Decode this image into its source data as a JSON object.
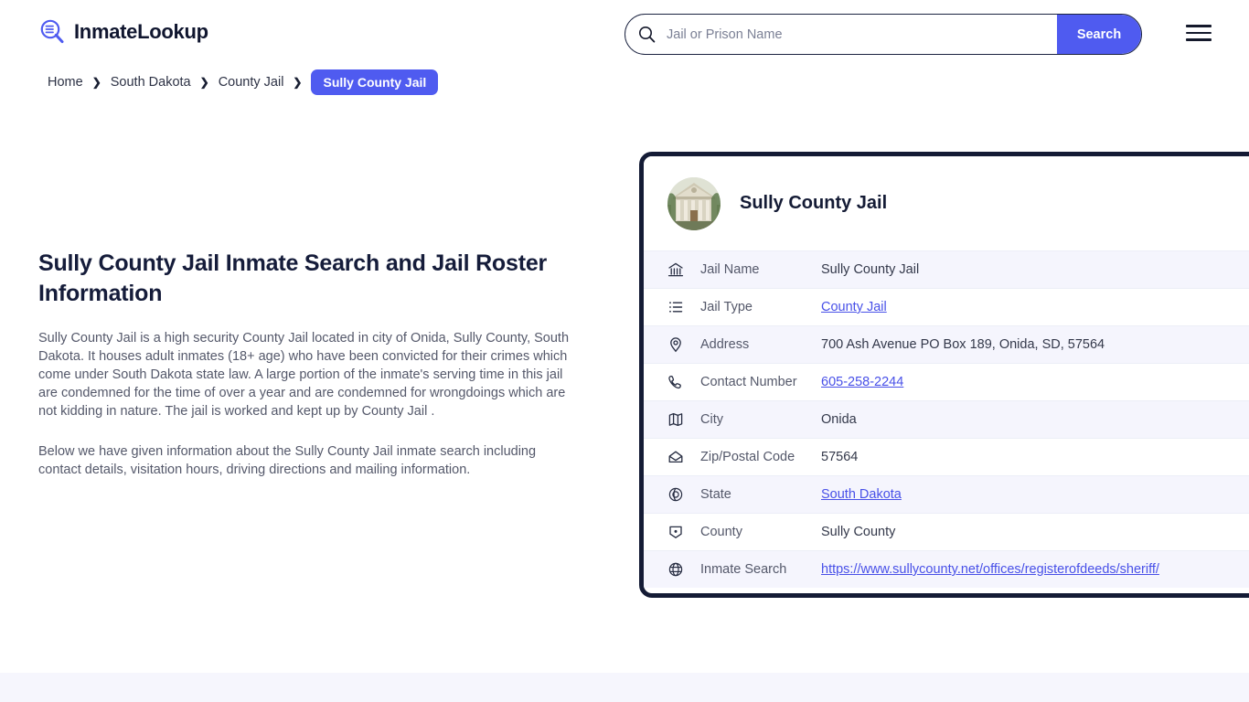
{
  "header": {
    "logo_text": "InmateLookup",
    "logo_icon": "magnifier-list-icon",
    "search": {
      "placeholder": "Jail or Prison Name",
      "value": "",
      "icon": "search-icon",
      "button_label": "Search"
    },
    "menu_icon": "hamburger-menu-icon"
  },
  "breadcrumb": {
    "items": [
      {
        "label": "Home",
        "current": false
      },
      {
        "label": "South Dakota",
        "current": false
      },
      {
        "label": "County Jail",
        "current": false
      },
      {
        "label": "Sully County Jail",
        "current": true
      }
    ],
    "separator": "❯"
  },
  "main": {
    "title": "Sully County Jail Inmate Search and Jail Roster Information",
    "paragraph1": "Sully County Jail is a high security County Jail located in city of Onida, Sully County, South Dakota. It houses adult inmates (18+ age) who have been convicted for their crimes which come under South Dakota state law. A large portion of the inmate's serving time in this jail are condemned for the time of over a year and are condemned for wrongdoings which are not kidding in nature. The jail is worked and kept up by County Jail .",
    "paragraph2": "Below we have given information about the Sully County Jail inmate search including contact details, visitation hours, driving directions and mailing information."
  },
  "card": {
    "avatar_alt": "courthouse-photo",
    "title": "Sully County Jail",
    "rows": [
      {
        "icon": "bank-icon",
        "label": "Jail Name",
        "value": "Sully County Jail",
        "link": false
      },
      {
        "icon": "list-icon",
        "label": "Jail Type",
        "value": "County Jail",
        "link": true
      },
      {
        "icon": "map-pin-icon",
        "label": "Address",
        "value": "700 Ash Avenue PO Box 189, Onida, SD, 57564",
        "link": false
      },
      {
        "icon": "phone-icon",
        "label": "Contact Number",
        "value": "605-258-2244",
        "link": true
      },
      {
        "icon": "map-icon",
        "label": "City",
        "value": "Onida",
        "link": false
      },
      {
        "icon": "envelope-icon",
        "label": "Zip/Postal Code",
        "value": "57564",
        "link": false
      },
      {
        "icon": "globe-pin-icon",
        "label": "State",
        "value": "South Dakota",
        "link": true
      },
      {
        "icon": "county-icon",
        "label": "County",
        "value": "Sully County",
        "link": false
      },
      {
        "icon": "globe-icon",
        "label": "Inmate Search",
        "value": "https://www.sullycounty.net/offices/registerofdeeds/sheriff/",
        "link": true
      }
    ]
  },
  "colors": {
    "accent": "#4f5bf0",
    "link": "#4850e8",
    "card_border": "#141b35",
    "row_alt": "#f5f5fd",
    "heading": "#151c3a",
    "body_text": "#54586a"
  }
}
